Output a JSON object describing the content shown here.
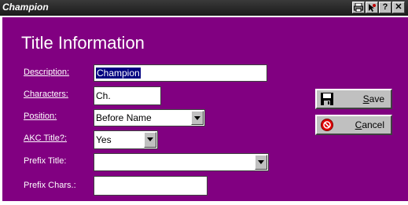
{
  "window": {
    "title": "Champion"
  },
  "titlebar_buttons": {
    "help": "?",
    "close": "✕"
  },
  "heading": "Title Information",
  "fields": {
    "description": {
      "label": "Description:",
      "value": "Champion"
    },
    "characters": {
      "label": "Characters:",
      "value": "Ch."
    },
    "position": {
      "label": "Position:",
      "value": "Before Name"
    },
    "akc_title": {
      "label": "AKC Title?:",
      "value": "Yes"
    },
    "prefix_title": {
      "label": "Prefix Title:",
      "value": ""
    },
    "prefix_chars": {
      "label": "Prefix Chars.:",
      "value": ""
    }
  },
  "buttons": {
    "save": {
      "label": "Save",
      "icon": "floppy-disk-icon"
    },
    "cancel": {
      "label": "Cancel",
      "icon": "cancel-icon"
    }
  },
  "colors": {
    "panel": "#810081",
    "titlebar": "#202020"
  }
}
